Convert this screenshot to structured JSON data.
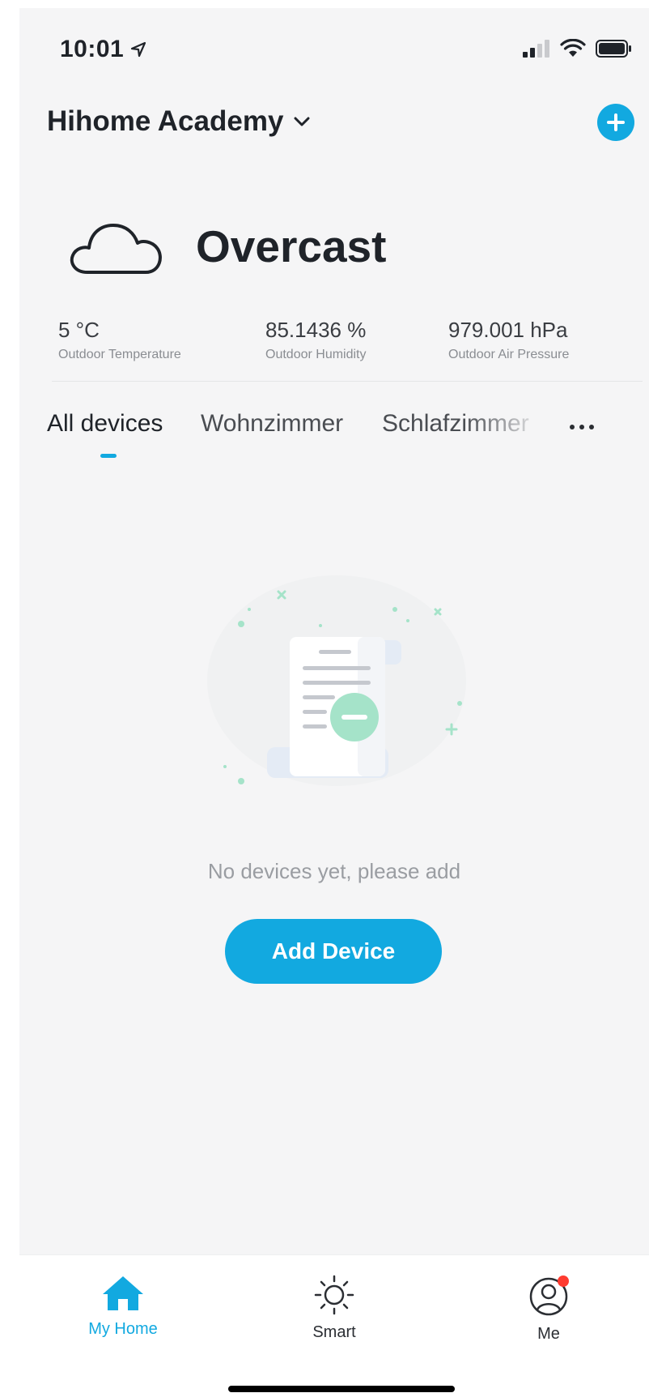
{
  "status_bar": {
    "time": "10:01"
  },
  "header": {
    "home_name": "Hihome Academy"
  },
  "weather": {
    "condition": "Overcast",
    "metrics": [
      {
        "value": "5 °C",
        "label": "Outdoor Temperature"
      },
      {
        "value": "85.1436 %",
        "label": "Outdoor Humidity"
      },
      {
        "value": "979.001 hPa",
        "label": "Outdoor Air Pressure"
      }
    ]
  },
  "tabs": [
    {
      "label": "All devices",
      "active": true
    },
    {
      "label": "Wohnzimmer",
      "active": false
    },
    {
      "label": "Schlafzimmer",
      "active": false
    }
  ],
  "empty_state": {
    "message": "No devices yet, please add",
    "button_label": "Add Device"
  },
  "tab_bar": {
    "items": [
      {
        "label": "My Home",
        "active": true
      },
      {
        "label": "Smart",
        "active": false
      },
      {
        "label": "Me",
        "active": false
      }
    ]
  },
  "colors": {
    "accent": "#12a9e0",
    "background": "#f5f5f6",
    "badge": "#ff3b30",
    "illustration_green": "#a5e3c9"
  }
}
